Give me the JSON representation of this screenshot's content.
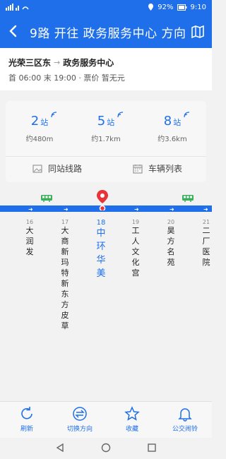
{
  "status": {
    "battery": "92%",
    "time": "9:10"
  },
  "header": {
    "title": "9路 开往 政务服务中心 方向"
  },
  "info": {
    "from": "光荣三区东",
    "arrow": "→",
    "to": "政务服务中心",
    "times": "首 06:00 末 19:00 · 票价 暂无元"
  },
  "stats": [
    {
      "num": "2",
      "unit": "站",
      "dist": "约480m"
    },
    {
      "num": "5",
      "unit": "站",
      "dist": "约1.7km"
    },
    {
      "num": "8",
      "unit": "站",
      "dist": "约3.6km"
    }
  ],
  "actions": {
    "same_station": "同站线路",
    "vehicle_list": "车辆列表"
  },
  "stops": [
    {
      "n": "16",
      "name": "大\n润\n发"
    },
    {
      "n": "17",
      "name": "大\n商\n新\n玛\n特\n新\n东\n方\n皮\n草"
    },
    {
      "n": "18",
      "name": "中\n环\n华\n美"
    },
    {
      "n": "19",
      "name": "工\n人\n文\n化\n宫"
    },
    {
      "n": "20",
      "name": "昊\n方\n名\n苑"
    },
    {
      "n": "21",
      "name": "二\n厂\n医\n院"
    }
  ],
  "tabs": {
    "refresh": "刷新",
    "switch": "切换方向",
    "fav": "收藏",
    "alarm": "公交闹铃"
  },
  "colors": {
    "accent": "#1f6fea"
  }
}
